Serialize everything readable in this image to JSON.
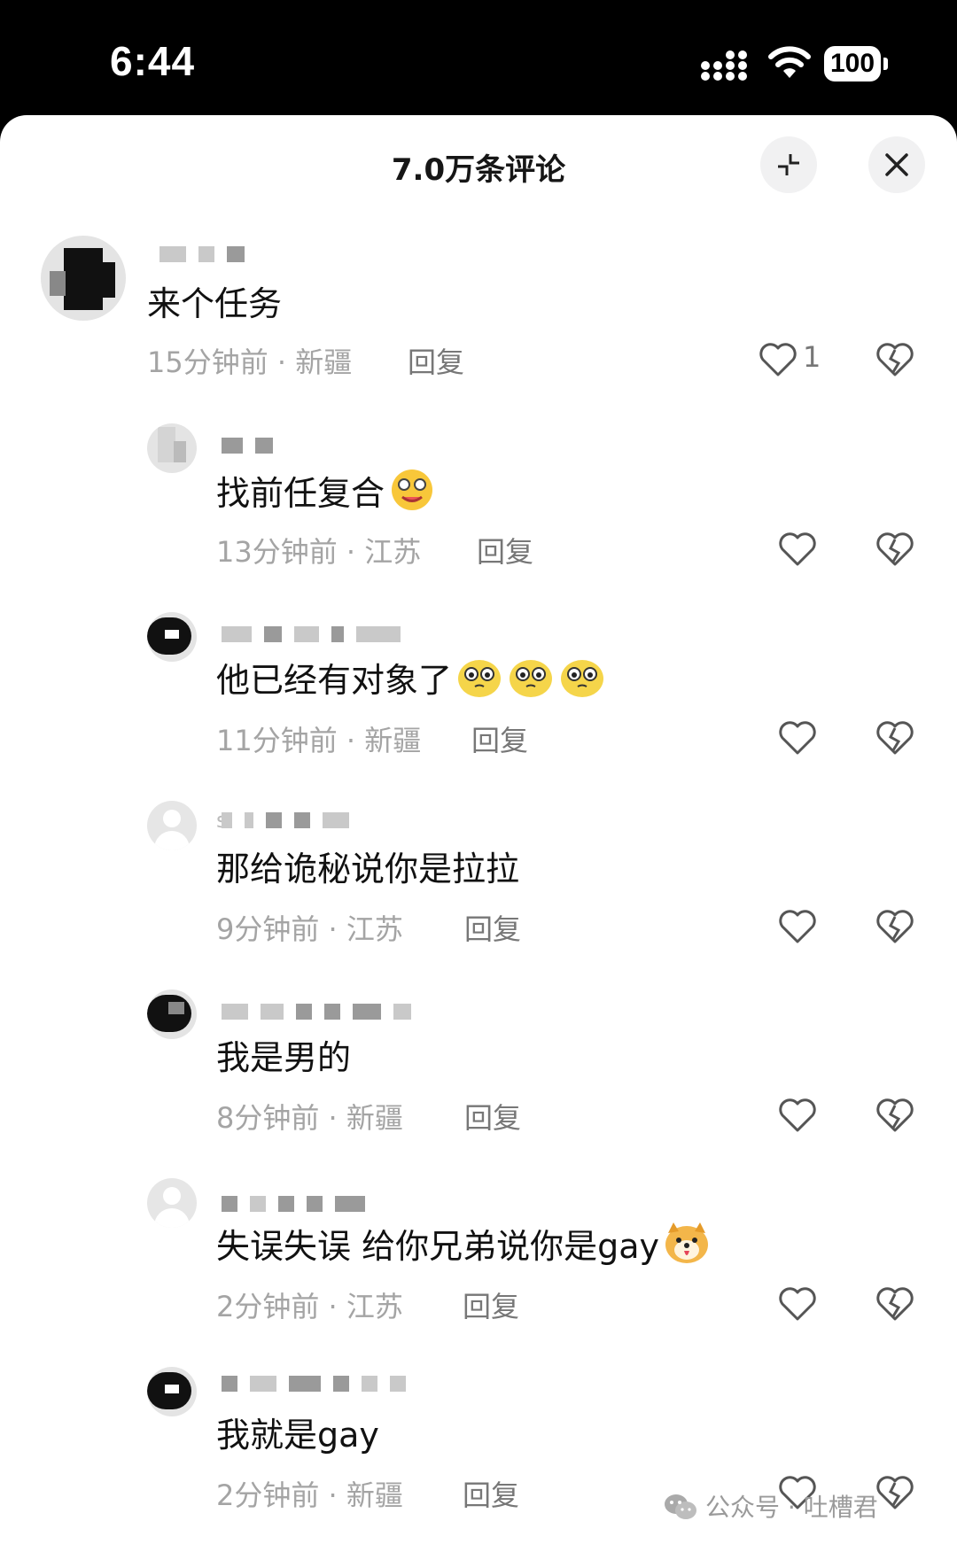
{
  "status_bar": {
    "time": "6:44",
    "battery": "100"
  },
  "sheet": {
    "title": "7.0万条评论"
  },
  "comments": [
    {
      "text": "来个任务",
      "time_location": "15分钟前 · 新疆",
      "reply": "回复",
      "likes": "1"
    },
    {
      "text": "找前任复合",
      "time_location": "13分钟前 · 江苏",
      "reply": "回复",
      "emojis": [
        "starry-eyes-emoji"
      ]
    },
    {
      "text": "他已经有对象了",
      "time_location": "11分钟前 · 新疆",
      "reply": "回复",
      "emojis": [
        "pleading-emoji",
        "pleading-emoji",
        "pleading-emoji"
      ]
    },
    {
      "name_initial": "s",
      "text": "那给诡秘说你是拉拉",
      "time_location": "9分钟前 · 江苏",
      "reply": "回复"
    },
    {
      "text": "我是男的",
      "time_location": "8分钟前 · 新疆",
      "reply": "回复"
    },
    {
      "text": "失误失误 给你兄弟说你是gay",
      "time_location": "2分钟前 · 江苏",
      "reply": "回复",
      "emojis": [
        "doge-emoji"
      ]
    },
    {
      "text": "我就是gay",
      "time_location": "2分钟前 · 新疆",
      "reply": "回复"
    }
  ],
  "watermark": "公众号 · 吐槽君"
}
